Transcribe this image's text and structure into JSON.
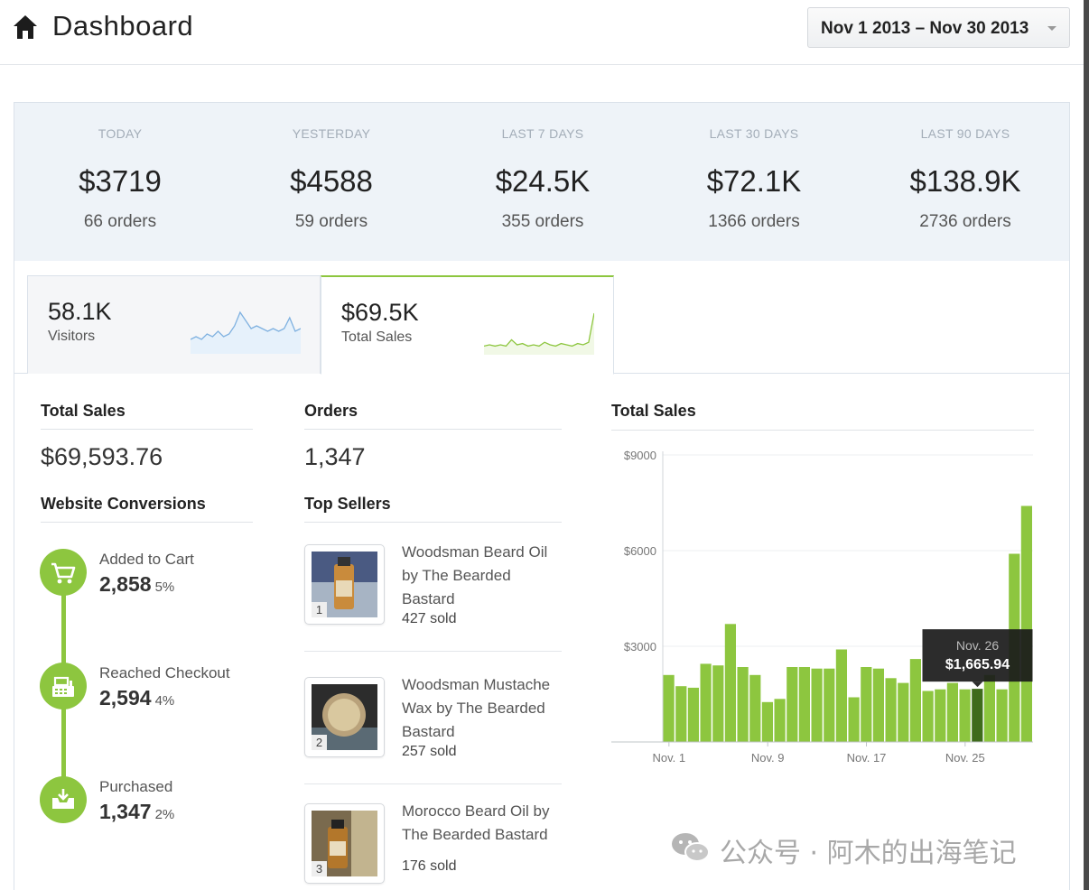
{
  "header": {
    "title": "Dashboard",
    "date_range": "Nov 1 2013 – Nov 30 2013"
  },
  "summary": [
    {
      "label": "TODAY",
      "value": "$3719",
      "orders": "66 orders"
    },
    {
      "label": "YESTERDAY",
      "value": "$4588",
      "orders": "59 orders"
    },
    {
      "label": "LAST 7 DAYS",
      "value": "$24.5K",
      "orders": "355 orders"
    },
    {
      "label": "LAST 30 DAYS",
      "value": "$72.1K",
      "orders": "1366 orders"
    },
    {
      "label": "LAST 90 DAYS",
      "value": "$138.9K",
      "orders": "2736 orders"
    }
  ],
  "tabs": [
    {
      "value": "58.1K",
      "label": "Visitors",
      "spark_color": "#7fb1e0",
      "spark_fill": "#e6f1fb",
      "spark": [
        4,
        5,
        4,
        6,
        5,
        7,
        5,
        6,
        9,
        14,
        11,
        8,
        9,
        8,
        7,
        8,
        7,
        8,
        12,
        7,
        8
      ]
    },
    {
      "value": "$69.5K",
      "label": "Total Sales",
      "spark_color": "#8dc63f",
      "spark_fill": "#f1f8e6",
      "spark": [
        4,
        5,
        4,
        5,
        4,
        9,
        5,
        6,
        4,
        5,
        4,
        7,
        5,
        4,
        6,
        5,
        4,
        6,
        5,
        7,
        30
      ]
    }
  ],
  "totals": {
    "total_sales_title": "Total Sales",
    "total_sales_value": "$69,593.76",
    "orders_title": "Orders",
    "orders_value": "1,347",
    "conversions_title": "Website Conversions",
    "top_sellers_title": "Top Sellers"
  },
  "conversions": [
    {
      "label": "Added to Cart",
      "value": "2,858",
      "pct": "5%",
      "icon": "cart-icon"
    },
    {
      "label": "Reached Checkout",
      "value": "2,594",
      "pct": "4%",
      "icon": "register-icon"
    },
    {
      "label": "Purchased",
      "value": "1,347",
      "pct": "2%",
      "icon": "inbox-download-icon"
    }
  ],
  "top_sellers": [
    {
      "rank": "1",
      "name": "Woodsman Beard Oil by The Bearded Bastard",
      "sold": "427 sold"
    },
    {
      "rank": "2",
      "name": "Woodsman Mustache Wax by The Bearded Bastard",
      "sold": "257 sold"
    },
    {
      "rank": "3",
      "name": "Morocco Beard Oil by The Bearded Bastard",
      "sold": "176 sold"
    }
  ],
  "colors": {
    "accent": "#8dc63f",
    "bar": "#8dc63f",
    "bar_highlight": "#3f6b1c",
    "tooltip_bg": "#1a1a1a"
  },
  "chart_data": {
    "type": "bar",
    "title": "Total Sales",
    "categories": [
      "Nov. 1",
      "Nov. 2",
      "Nov. 3",
      "Nov. 4",
      "Nov. 5",
      "Nov. 6",
      "Nov. 7",
      "Nov. 8",
      "Nov. 9",
      "Nov. 10",
      "Nov. 11",
      "Nov. 12",
      "Nov. 13",
      "Nov. 14",
      "Nov. 15",
      "Nov. 16",
      "Nov. 17",
      "Nov. 18",
      "Nov. 19",
      "Nov. 20",
      "Nov. 21",
      "Nov. 22",
      "Nov. 23",
      "Nov. 24",
      "Nov. 25",
      "Nov. 26",
      "Nov. 27",
      "Nov. 28",
      "Nov. 29",
      "Nov. 30"
    ],
    "values": [
      2100,
      1750,
      1700,
      2450,
      2400,
      3700,
      2350,
      2100,
      1250,
      1350,
      2350,
      2350,
      2300,
      2300,
      2900,
      1400,
      2350,
      2300,
      2000,
      1850,
      2600,
      1600,
      1650,
      1850,
      1650,
      1665.94,
      2100,
      1650,
      5900,
      7400
    ],
    "x_tick_labels": [
      "Nov. 1",
      "Nov. 9",
      "Nov. 17",
      "Nov. 25"
    ],
    "x_tick_index": [
      0,
      8,
      16,
      24
    ],
    "y_tick_labels": [
      "$9000",
      "$6000",
      "$3000"
    ],
    "y_tick_values": [
      9000,
      6000,
      3000
    ],
    "ylim": [
      0,
      9000
    ],
    "grid": true,
    "highlight_index": 25,
    "tooltip": {
      "date": "Nov. 26",
      "value": "$1,665.94"
    }
  },
  "watermark": {
    "text": "公众号 · 阿木的出海笔记"
  }
}
